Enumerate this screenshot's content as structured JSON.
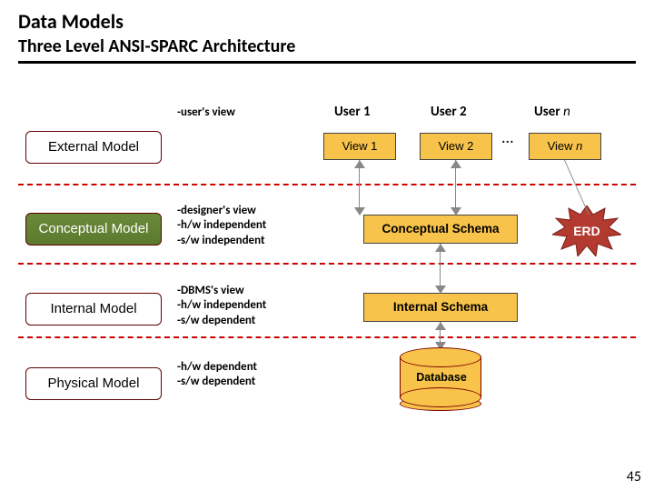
{
  "header": {
    "title": "Data Models",
    "subtitle": "Three Level ANSI-SPARC Architecture"
  },
  "models": {
    "external": {
      "name": "External Model",
      "desc": "-user's view"
    },
    "conceptual": {
      "name": "Conceptual Model",
      "desc": "-designer's view\n-h/w independent\n-s/w independent"
    },
    "internal": {
      "name": "Internal Model",
      "desc": "-DBMS's view\n-h/w independent\n-s/w dependent"
    },
    "physical": {
      "name": "Physical Model",
      "desc": "-h/w dependent\n-s/w dependent"
    }
  },
  "users": {
    "u1": "User 1",
    "u2": "User 2",
    "un_prefix": "User ",
    "un_n": "n",
    "ellipsis": "..."
  },
  "views": {
    "v1": "View 1",
    "v2": "View 2",
    "vn_prefix": "View ",
    "vn_n": "n"
  },
  "schemas": {
    "conceptual": "Conceptual Schema",
    "internal": "Internal Schema"
  },
  "erd": "ERD",
  "database": "Database",
  "page": "45",
  "chart_data": {
    "type": "table",
    "title": "Three Level ANSI-SPARC Architecture",
    "levels": [
      {
        "level": "External Model",
        "properties": [
          "user's view"
        ],
        "artifacts": [
          "View 1",
          "View 2",
          "View n"
        ]
      },
      {
        "level": "Conceptual Model",
        "properties": [
          "designer's view",
          "h/w independent",
          "s/w independent"
        ],
        "artifacts": [
          "Conceptual Schema",
          "ERD"
        ]
      },
      {
        "level": "Internal Model",
        "properties": [
          "DBMS's view",
          "h/w independent",
          "s/w dependent"
        ],
        "artifacts": [
          "Internal Schema"
        ]
      },
      {
        "level": "Physical Model",
        "properties": [
          "h/w dependent",
          "s/w dependent"
        ],
        "artifacts": [
          "Database"
        ]
      }
    ],
    "users": [
      "User 1",
      "User 2",
      "User n"
    ]
  }
}
